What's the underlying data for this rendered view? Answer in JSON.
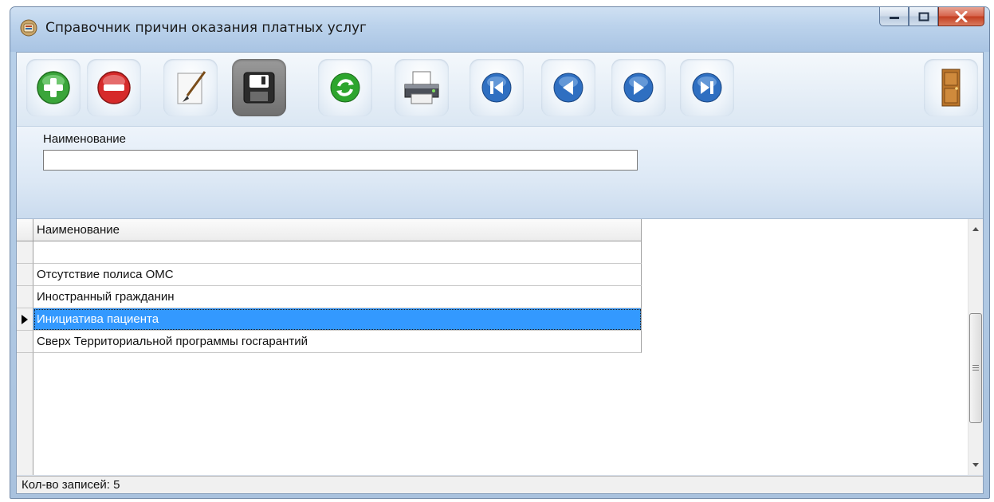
{
  "window": {
    "title": "Справочник причин оказания платных услуг",
    "app_icon": "app-database-icon"
  },
  "window_controls": [
    "minimize-icon",
    "maximize-icon",
    "close-icon"
  ],
  "toolbar": {
    "buttons": [
      {
        "name": "add",
        "icon": "plus-circle-icon"
      },
      {
        "name": "delete",
        "icon": "minus-circle-icon"
      },
      {
        "name": "edit",
        "icon": "brush-edit-icon"
      },
      {
        "name": "save",
        "icon": "floppy-disk-icon",
        "pressed": true
      },
      {
        "name": "refresh",
        "icon": "refresh-icon"
      },
      {
        "name": "print",
        "icon": "printer-icon"
      },
      {
        "name": "first",
        "icon": "first-record-icon"
      },
      {
        "name": "previous",
        "icon": "previous-record-icon"
      },
      {
        "name": "next",
        "icon": "next-record-icon"
      },
      {
        "name": "last",
        "icon": "last-record-icon"
      },
      {
        "name": "exit",
        "icon": "door-exit-icon"
      }
    ]
  },
  "filter": {
    "label": "Наименование",
    "value": ""
  },
  "grid": {
    "column_header": "Наименование",
    "rows": [
      "",
      "Отсутствие полиса ОМС",
      "Иностранный гражданин",
      "Инициатива пациента",
      "Сверх Территориальной программы госгарантий"
    ],
    "selected_index": 3
  },
  "status": {
    "text": "Кол-во записей: 5"
  },
  "colors": {
    "selection": "#3399ff",
    "frame": "#b9d1ea",
    "close_button": "#c33d20"
  }
}
